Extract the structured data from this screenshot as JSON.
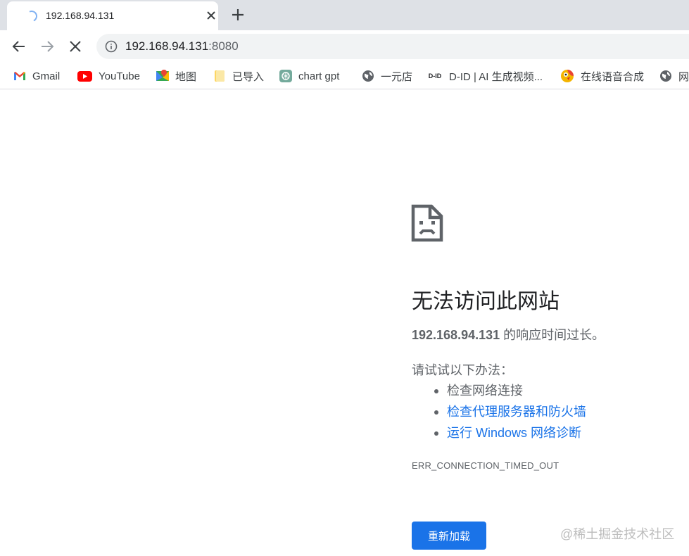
{
  "tab": {
    "title": "192.168.94.131",
    "close_icon": "close-icon",
    "new_tab_icon": "plus-icon"
  },
  "toolbar": {
    "url_host": "192.168.94.131",
    "url_port": ":8080"
  },
  "bookmarks": [
    {
      "label": "Gmail",
      "icon": "gmail-icon"
    },
    {
      "label": "YouTube",
      "icon": "youtube-icon"
    },
    {
      "label": "地图",
      "icon": "maps-icon"
    },
    {
      "label": "已导入",
      "icon": "folder-icon"
    },
    {
      "label": "chart gpt",
      "icon": "chatgpt-icon"
    },
    {
      "label": "一元店",
      "icon": "globe-icon"
    },
    {
      "label": "D-ID | AI 生成视频...",
      "icon": "d-id-icon",
      "icon_text": "D-ID"
    },
    {
      "label": "在线语音合成",
      "icon": "parrot-icon"
    },
    {
      "label": "网",
      "icon": "globe-icon"
    }
  ],
  "error": {
    "heading": "无法访问此网站",
    "host": "192.168.94.131",
    "summary_suffix": " 的响应时间过长。",
    "suggestions_title": "请试试以下办法：",
    "suggestions": [
      {
        "text": "检查网络连接",
        "link": false
      },
      {
        "text": "检查代理服务器和防火墙",
        "link": true
      },
      {
        "text": "运行 Windows 网络诊断",
        "link": true
      }
    ],
    "code": "ERR_CONNECTION_TIMED_OUT",
    "reload_label": "重新加载"
  },
  "watermark": "@稀土掘金技术社区",
  "colors": {
    "accent": "#1a73e8",
    "tabstrip": "#dee1e6",
    "omnibox": "#f1f3f4",
    "text_secondary": "#5f6368"
  }
}
